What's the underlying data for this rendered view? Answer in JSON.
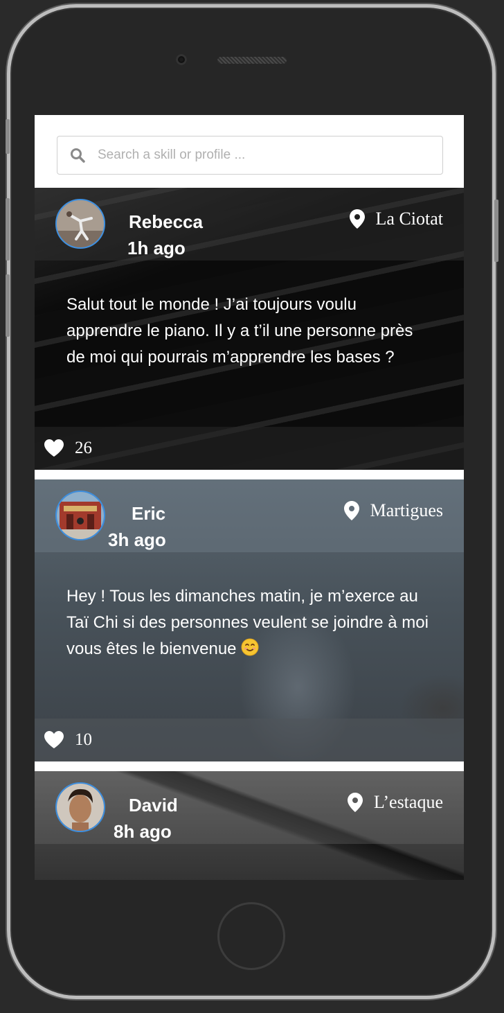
{
  "search": {
    "placeholder": "Search a skill or profile ..."
  },
  "posts": [
    {
      "author": "Rebecca",
      "time": "1h ago",
      "location": "La Ciotat",
      "body": "Salut tout le monde ! J’ai toujours voulu apprendre le piano. Il y a t’il une personne près de moi qui pourrais m’apprendre les bases ?",
      "likes": "26"
    },
    {
      "author": "Eric",
      "time": "3h ago",
      "location": "Martigues",
      "body": "Hey ! Tous les dimanches matin, je m’exerce au Taï Chi si des personnes veulent se joindre à moi vous êtes le bienvenue",
      "likes": "10"
    },
    {
      "author": "David",
      "time": "8h ago",
      "location": "L’estaque"
    }
  ],
  "colors": {
    "avatar_border": "#3d8fe0",
    "search_background": "#ffffff",
    "separator": "#ffffff"
  },
  "icons": {
    "search": "search-icon",
    "location": "pin-icon",
    "like": "heart-icon",
    "emoji": "smiling-face-emoji"
  }
}
